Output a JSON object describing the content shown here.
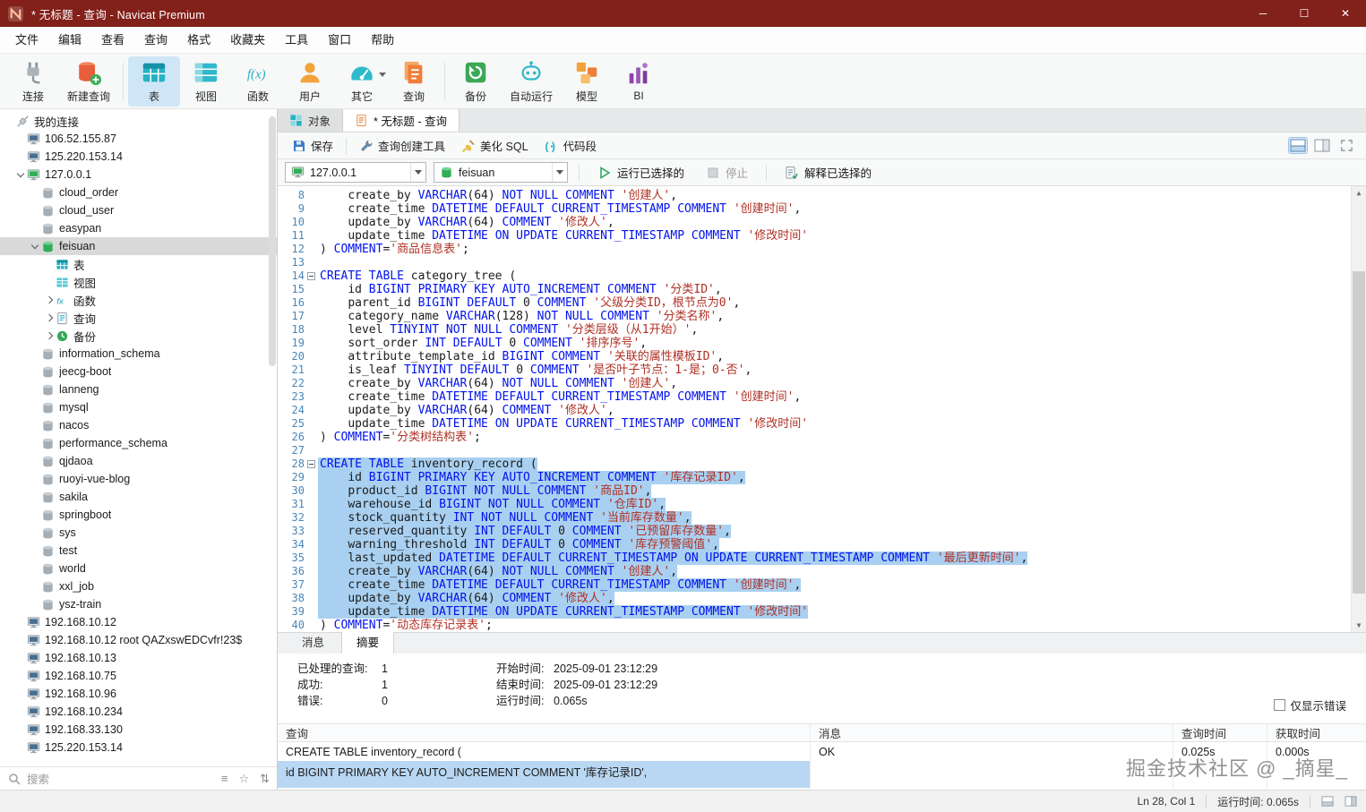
{
  "window": {
    "title": "* 无标题 - 查询 - Navicat Premium",
    "controls": {
      "minimize": "─",
      "maximize": "☐",
      "close": "✕"
    }
  },
  "menubar": {
    "items": [
      "文件",
      "编辑",
      "查看",
      "查询",
      "格式",
      "收藏夹",
      "工具",
      "窗口",
      "帮助"
    ]
  },
  "toolbar": {
    "items": [
      {
        "id": "connect",
        "label": "连接",
        "icon": "plug",
        "group_end": false
      },
      {
        "id": "new-query",
        "label": "新建查询",
        "icon": "newquery",
        "group_end": true
      },
      {
        "id": "table",
        "label": "表",
        "icon": "bigtable",
        "selected": true
      },
      {
        "id": "view",
        "label": "视图",
        "icon": "bigview"
      },
      {
        "id": "function",
        "label": "函数",
        "icon": "bigfunc"
      },
      {
        "id": "user",
        "label": "用户",
        "icon": "biguser"
      },
      {
        "id": "others",
        "label": "其它",
        "icon": "gauge",
        "has_dropdown": true
      },
      {
        "id": "query",
        "label": "查询",
        "icon": "querydoc",
        "group_end": true
      },
      {
        "id": "backup",
        "label": "备份",
        "icon": "backup"
      },
      {
        "id": "automation",
        "label": "自动运行",
        "icon": "robot"
      },
      {
        "id": "model",
        "label": "模型",
        "icon": "model"
      },
      {
        "id": "bi",
        "label": "BI",
        "icon": "bi"
      }
    ]
  },
  "sidebar": {
    "root": {
      "label": "我的连接"
    },
    "tree": [
      {
        "label": "106.52.155.87",
        "level": 1,
        "icon": "server"
      },
      {
        "label": "125.220.153.14",
        "level": 1,
        "icon": "server"
      },
      {
        "label": "127.0.0.1",
        "level": 1,
        "icon": "serveropen",
        "chev": "down"
      },
      {
        "label": "cloud_order",
        "level": 2,
        "icon": "db"
      },
      {
        "label": "cloud_user",
        "level": 2,
        "icon": "db"
      },
      {
        "label": "easypan",
        "level": 2,
        "icon": "db"
      },
      {
        "label": "feisuan",
        "level": 2,
        "icon": "dbopen",
        "chev": "down",
        "selected": true
      },
      {
        "label": "表",
        "level": 3,
        "icon": "tables"
      },
      {
        "label": "视图",
        "level": 3,
        "icon": "views"
      },
      {
        "label": "函数",
        "level": 3,
        "icon": "functions",
        "chev": "right"
      },
      {
        "label": "查询",
        "level": 3,
        "icon": "queries",
        "chev": "right"
      },
      {
        "label": "备份",
        "level": 3,
        "icon": "backups",
        "chev": "right"
      },
      {
        "label": "information_schema",
        "level": 2,
        "icon": "db"
      },
      {
        "label": "jeecg-boot",
        "level": 2,
        "icon": "db"
      },
      {
        "label": "lanneng",
        "level": 2,
        "icon": "db"
      },
      {
        "label": "mysql",
        "level": 2,
        "icon": "db"
      },
      {
        "label": "nacos",
        "level": 2,
        "icon": "db"
      },
      {
        "label": "performance_schema",
        "level": 2,
        "icon": "db"
      },
      {
        "label": "qjdaoa",
        "level": 2,
        "icon": "db"
      },
      {
        "label": "ruoyi-vue-blog",
        "level": 2,
        "icon": "db"
      },
      {
        "label": "sakila",
        "level": 2,
        "icon": "db"
      },
      {
        "label": "springboot",
        "level": 2,
        "icon": "db"
      },
      {
        "label": "sys",
        "level": 2,
        "icon": "db"
      },
      {
        "label": "test",
        "level": 2,
        "icon": "db"
      },
      {
        "label": "world",
        "level": 2,
        "icon": "db"
      },
      {
        "label": "xxl_job",
        "level": 2,
        "icon": "db"
      },
      {
        "label": "ysz-train",
        "level": 2,
        "icon": "db"
      },
      {
        "label": "192.168.10.12",
        "level": 1,
        "icon": "server"
      },
      {
        "label": "192.168.10.12 root QAZxswEDCvfr!23$",
        "level": 1,
        "icon": "server"
      },
      {
        "label": "192.168.10.13",
        "level": 1,
        "icon": "server"
      },
      {
        "label": "192.168.10.75",
        "level": 1,
        "icon": "server"
      },
      {
        "label": "192.168.10.96",
        "level": 1,
        "icon": "server"
      },
      {
        "label": "192.168.10.234",
        "level": 1,
        "icon": "server"
      },
      {
        "label": "192.168.33.130",
        "level": 1,
        "icon": "server"
      },
      {
        "label": "125.220.153.14",
        "level": 1,
        "icon": "server"
      }
    ],
    "search": {
      "placeholder": "搜索"
    }
  },
  "doc_tabs": [
    {
      "label": "对象",
      "icon": "objects",
      "active": false
    },
    {
      "label": "* 无标题 - 查询",
      "icon": "querytab",
      "active": true
    }
  ],
  "query_toolbar": {
    "save": "保存",
    "builder": "查询创建工具",
    "beautify": "美化 SQL",
    "snippet": "代码段"
  },
  "conn_bar": {
    "connection": "127.0.0.1",
    "database": "feisuan",
    "run": "运行已选择的",
    "stop": "停止",
    "explain": "解释已选择的"
  },
  "editor": {
    "first_line": 8,
    "selection": [
      28,
      39
    ],
    "fold_lines": [
      14,
      28
    ],
    "keywords": [
      "CREATE",
      "TABLE",
      "VARCHAR",
      "NOT",
      "NULL",
      "COMMENT",
      "DATETIME",
      "DEFAULT",
      "CURRENT_TIMESTAMP",
      "ON",
      "UPDATE",
      "BIGINT",
      "PRIMARY",
      "KEY",
      "AUTO_INCREMENT",
      "INT",
      "TINYINT"
    ],
    "lines": [
      "    create_by VARCHAR(64) NOT NULL COMMENT '创建人',",
      "    create_time DATETIME DEFAULT CURRENT_TIMESTAMP COMMENT '创建时间',",
      "    update_by VARCHAR(64) COMMENT '修改人',",
      "    update_time DATETIME ON UPDATE CURRENT_TIMESTAMP COMMENT '修改时间'",
      ") COMMENT='商品信息表';",
      "",
      "CREATE TABLE category_tree (",
      "    id BIGINT PRIMARY KEY AUTO_INCREMENT COMMENT '分类ID',",
      "    parent_id BIGINT DEFAULT 0 COMMENT '父级分类ID，根节点为0',",
      "    category_name VARCHAR(128) NOT NULL COMMENT '分类名称',",
      "    level TINYINT NOT NULL COMMENT '分类层级（从1开始）',",
      "    sort_order INT DEFAULT 0 COMMENT '排序序号',",
      "    attribute_template_id BIGINT COMMENT '关联的属性模板ID',",
      "    is_leaf TINYINT DEFAULT 0 COMMENT '是否叶子节点：1-是；0-否',",
      "    create_by VARCHAR(64) NOT NULL COMMENT '创建人',",
      "    create_time DATETIME DEFAULT CURRENT_TIMESTAMP COMMENT '创建时间',",
      "    update_by VARCHAR(64) COMMENT '修改人',",
      "    update_time DATETIME ON UPDATE CURRENT_TIMESTAMP COMMENT '修改时间'",
      ") COMMENT='分类树结构表';",
      "",
      "CREATE TABLE inventory_record (",
      "    id BIGINT PRIMARY KEY AUTO_INCREMENT COMMENT '库存记录ID',",
      "    product_id BIGINT NOT NULL COMMENT '商品ID',",
      "    warehouse_id BIGINT NOT NULL COMMENT '仓库ID',",
      "    stock_quantity INT NOT NULL COMMENT '当前库存数量',",
      "    reserved_quantity INT DEFAULT 0 COMMENT '已预留库存数量',",
      "    warning_threshold INT DEFAULT 0 COMMENT '库存预警阈值',",
      "    last_updated DATETIME DEFAULT CURRENT_TIMESTAMP ON UPDATE CURRENT_TIMESTAMP COMMENT '最后更新时间',",
      "    create_by VARCHAR(64) NOT NULL COMMENT '创建人',",
      "    create_time DATETIME DEFAULT CURRENT_TIMESTAMP COMMENT '创建时间',",
      "    update_by VARCHAR(64) COMMENT '修改人',",
      "    update_time DATETIME ON UPDATE CURRENT_TIMESTAMP COMMENT '修改时间'",
      ") COMMENT='动态库存记录表';"
    ]
  },
  "result_tabs": [
    {
      "label": "消息",
      "active": false
    },
    {
      "label": "摘要",
      "active": true
    }
  ],
  "summary": {
    "processed_label": "已处理的查询:",
    "processed": "1",
    "success_label": "成功:",
    "success": "1",
    "error_label": "错误:",
    "errors": "0",
    "start_label": "开始时间:",
    "start": "2025-09-01 23:12:29",
    "end_label": "结束时间:",
    "end": "2025-09-01 23:12:29",
    "duration_label": "运行时间:",
    "duration": "0.065s",
    "only_errors": "仅显示错误"
  },
  "results": {
    "columns": [
      "查询",
      "消息",
      "查询时间",
      "获取时间"
    ],
    "rows": [
      {
        "query": "CREATE TABLE inventory_record (",
        "message": "OK",
        "query_time": "0.025s",
        "fetch_time": "0.000s"
      }
    ],
    "partial_query": "    id BIGINT PRIMARY KEY AUTO_INCREMENT COMMENT '库存记录ID',"
  },
  "watermark": "掘金技术社区 @ _摘星_",
  "statusbar": {
    "position": "Ln 28, Col 1",
    "runtime": "运行时间: 0.065s"
  },
  "colors": {
    "titlebar": "#82201a",
    "keyword": "#0012ee",
    "string": "#b03024",
    "selection": "#a9d0f0",
    "tree_selected": "#d9d9d9"
  }
}
